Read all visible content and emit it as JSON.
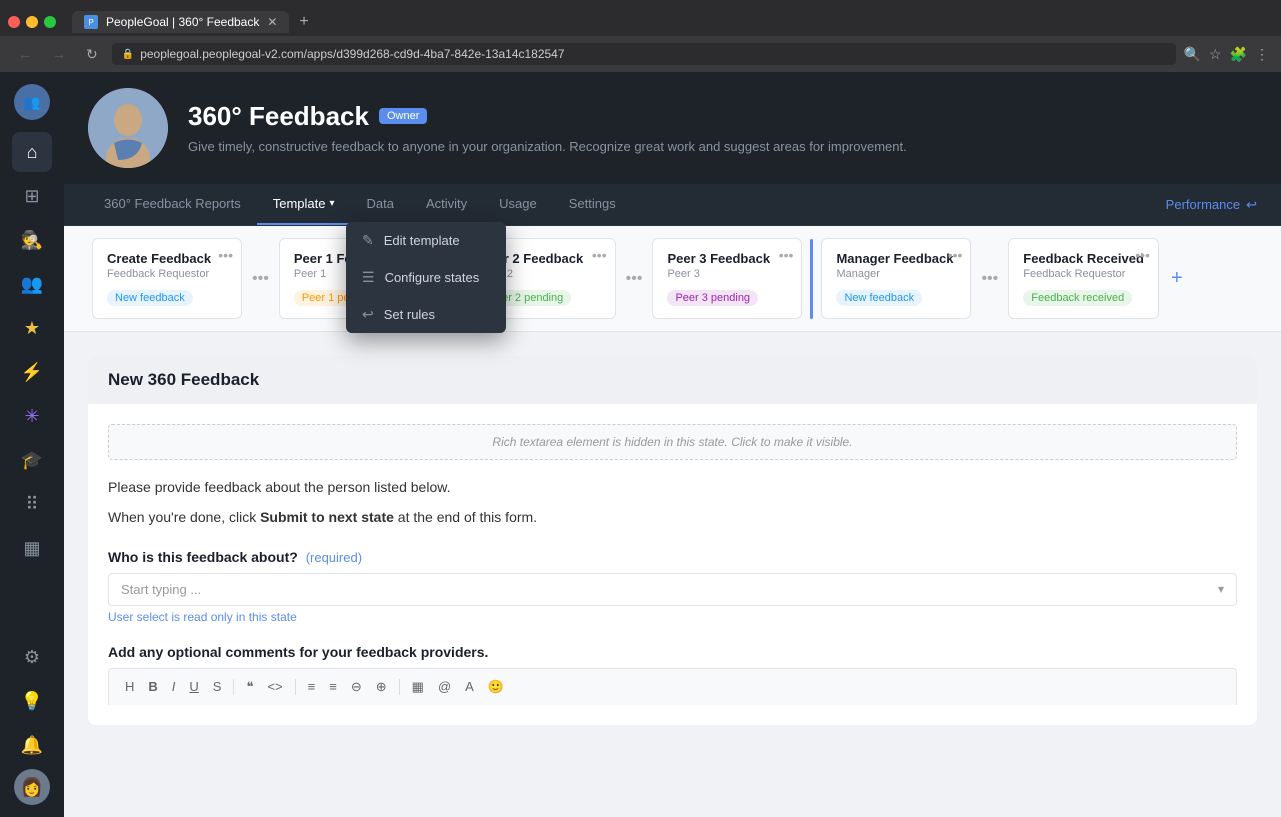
{
  "browser": {
    "tab_title": "PeopleGoal | 360° Feedback",
    "url": "peoplegoal.peoplegoal-v2.com/apps/d399d268-cd9d-4ba7-842e-13a14c182547",
    "new_tab_label": "+",
    "back_icon": "←",
    "forward_icon": "→",
    "refresh_icon": "↻",
    "lock_icon": "🔒"
  },
  "sidebar": {
    "items": [
      {
        "id": "home",
        "icon": "⌂",
        "label": "Home"
      },
      {
        "id": "dashboard",
        "icon": "⊞",
        "label": "Dashboard"
      },
      {
        "id": "people-red",
        "icon": "👤",
        "label": "People",
        "accent": "accent-red"
      },
      {
        "id": "feedback-orange",
        "icon": "👥",
        "label": "Feedback",
        "accent": "accent-orange"
      },
      {
        "id": "goals-yellow",
        "icon": "★",
        "label": "Goals",
        "accent": "accent-yellow"
      },
      {
        "id": "lightning-green",
        "icon": "⚡",
        "label": "Lightning",
        "accent": "accent-green"
      },
      {
        "id": "asterisk-purple",
        "icon": "✳",
        "label": "Asterisk",
        "accent": "accent-purple"
      },
      {
        "id": "graduation",
        "icon": "🎓",
        "label": "Learning"
      },
      {
        "id": "hierarchy",
        "icon": "⠿",
        "label": "Hierarchy"
      },
      {
        "id": "table",
        "icon": "▦",
        "label": "Table"
      }
    ],
    "bottom_items": [
      {
        "id": "settings",
        "icon": "⚙",
        "label": "Settings"
      },
      {
        "id": "bulb",
        "icon": "💡",
        "label": "Tips"
      },
      {
        "id": "bell",
        "icon": "🔔",
        "label": "Notifications"
      }
    ]
  },
  "header": {
    "app_title": "360° Feedback",
    "owner_badge": "Owner",
    "description": "Give timely, constructive feedback to anyone in your organization. Recognize great work and suggest areas for improvement."
  },
  "nav": {
    "tabs": [
      {
        "id": "reports",
        "label": "360° Feedback Reports",
        "active": false
      },
      {
        "id": "template",
        "label": "Template",
        "active": true,
        "has_chevron": true
      },
      {
        "id": "data",
        "label": "Data",
        "active": false
      },
      {
        "id": "activity",
        "label": "Activity",
        "active": false
      },
      {
        "id": "usage",
        "label": "Usage",
        "active": false
      },
      {
        "id": "settings",
        "label": "Settings",
        "active": false
      }
    ],
    "performance_label": "Performance",
    "performance_icon": "↩"
  },
  "dropdown": {
    "items": [
      {
        "id": "edit-template",
        "icon": "✎",
        "label": "Edit template"
      },
      {
        "id": "configure-states",
        "icon": "☰",
        "label": "Configure states"
      },
      {
        "id": "set-rules",
        "icon": "↩",
        "label": "Set rules"
      }
    ]
  },
  "pipeline": {
    "stages": [
      {
        "id": "create-feedback",
        "title": "Create Feedback",
        "sub": "Feedback Requestor",
        "badge": "New feedback",
        "badge_class": "badge-new-feedback",
        "active": false
      },
      {
        "id": "peer1-feedback",
        "title": "Peer 1 Feedback",
        "sub": "Peer 1",
        "badge": "Peer 1 pending",
        "badge_class": "badge-peer1-pending",
        "active": false
      },
      {
        "id": "peer2-feedback",
        "title": "Peer 2 Feedback",
        "sub": "Peer 2",
        "badge": "Peer 2 pending",
        "badge_class": "badge-peer2-pending",
        "active": false
      },
      {
        "id": "peer3-feedback",
        "title": "Peer 3 Feedback",
        "sub": "Peer 3",
        "badge": "Peer 3 pending",
        "badge_class": "badge-peer3-pending",
        "active": false
      },
      {
        "id": "manager-feedback",
        "title": "Manager Feedback",
        "sub": "Manager",
        "badge": "New feedback",
        "badge_class": "badge-manager-new",
        "active": false
      },
      {
        "id": "feedback-received",
        "title": "Feedback Received",
        "sub": "Feedback Requestor",
        "badge": "Feedback received",
        "badge_class": "badge-received",
        "active": false
      }
    ],
    "add_icon": "+"
  },
  "form": {
    "title": "New 360 Feedback",
    "hidden_notice": "Rich textarea element is hidden in this state. Click to make it visible.",
    "instruction1": "Please provide feedback about the person listed below.",
    "instruction2_prefix": "When you're done, click ",
    "instruction2_bold": "Submit to next state",
    "instruction2_suffix": " at the end of this form.",
    "who_label": "Who is this feedback about?",
    "who_required": "(required)",
    "who_placeholder": "Start typing ...",
    "who_hint": "User select is read only in this state",
    "comments_label": "Add any optional comments for your feedback providers.",
    "toolbar_items": [
      "H",
      "B",
      "I",
      "U",
      "S",
      "—",
      "«»",
      "‹›",
      "—",
      "≡",
      "≡",
      "⊖",
      "⊕",
      "—",
      "☰",
      "👤",
      "💧",
      "😊"
    ]
  }
}
